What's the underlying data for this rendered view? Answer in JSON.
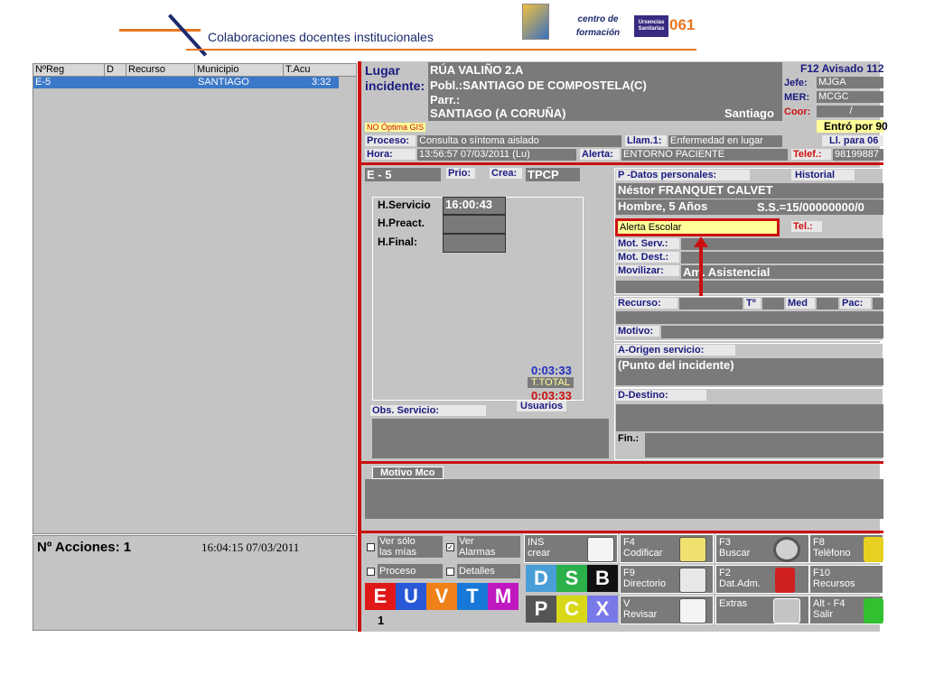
{
  "header": {
    "title": "Colaboraciones docentes institucionales",
    "logo_cf": "centro de formación",
    "logo_urg": "Urxencias Sanitarias",
    "logo_num": "061"
  },
  "list": {
    "columns": [
      "NºReg",
      "D",
      "Recurso",
      "Municipio",
      "T.Acu"
    ],
    "row": {
      "reg": "E-5",
      "municipio": "SANTIAGO",
      "tacu": "3:32"
    }
  },
  "acciones": {
    "label": "Nº Acciones: 1",
    "datetime": "16:04:15  07/03/2011"
  },
  "incident": {
    "lugar_label": "Lugar\nincidente:",
    "addr1": "RÚA VALIÑO 2.A",
    "addr2": "Pobl.:SANTIAGO DE COMPOSTELA(C)",
    "addr3": "Parr.:",
    "addr4": "SANTIAGO  (A CORUÑA)",
    "addr4b": "Santiago",
    "f12": "F12 Avisado 112",
    "jefe_l": "Jefe:",
    "jefe": "MJGA",
    "mer_l": "MER:",
    "mer": "MCGC",
    "coor_l": "Coor:",
    "coor": "/",
    "entro": "Entró por 90",
    "gis": "NO Óptima GIS",
    "proceso_l": "Proceso:",
    "proceso": "Consulta o síntoma aislado",
    "llam_l": "Llam.1:",
    "llam": "Enfermedad en lugar",
    "li": "Ll. para 06",
    "hora_l": "Hora:",
    "hora": "13:56:57  07/03/2011  (Lu)",
    "alerta_l": "Alerta:",
    "alerta": "ENTORNO PACIENTE",
    "telef_l": "Telef.:",
    "telef": "98199887"
  },
  "service": {
    "code": "E - 5",
    "prio_l": "Prio:",
    "crea_l": "Crea:",
    "crea": "TPCP",
    "h_servicio_l": "H.Servicio",
    "h_servicio": "16:00:43",
    "h_preact_l": "H.Preact.",
    "h_final_l": "H.Final:",
    "t1": "0:03:33",
    "ttotal": "T.TOTAL",
    "t2": "0:03:33",
    "obs_l": "Obs. Servicio:",
    "usuarios": "Usuarios"
  },
  "patient": {
    "datos_l": "P -Datos personales:",
    "historial": "Historial",
    "name": "Néstor FRANQUET CALVET",
    "sex_age": "Hombre, 5 Años",
    "ss": "S.S.=15/00000000/0",
    "alerta_esc": "Alerta Escolar",
    "tel_l": "Tel.:",
    "mot_serv_l": "Mot. Serv.:",
    "mot_dest_l": "Mot. Dest.:",
    "movilizar_l": "Movilizar:",
    "movilizar": "Am. Asistencial",
    "recurso_l": "Recurso:",
    "tp_l": "Tº",
    "med_l": "Med",
    "pac_l": "Pac:",
    "motivo_l": "Motivo:",
    "origen_l": "A-Origen servicio:",
    "origen": "(Punto del incidente)",
    "destino_l": "D-Destino:",
    "fin_l": "Fin.:"
  },
  "motivo_mco": "Motivo Mco",
  "controls": {
    "ver_solo": "Ver sólo\nlas mías",
    "ver_alarmas": "Ver\nAlarmas",
    "proceso": "Proceso",
    "detalles": "Detalles",
    "letters": [
      "D",
      "S",
      "B",
      "P",
      "C",
      "X",
      "E",
      "U",
      "V",
      "T",
      "M"
    ],
    "count": "1",
    "ins": "INS\ncrear",
    "f4": "F4\nCodificar",
    "f3": "F3\nBuscar",
    "f8": "F8\nTeléfono",
    "f9": "F9\nDirectorio",
    "f2": "F2\nDat.Adm.",
    "f10": "F10\nRecursos",
    "v": "V\nRevisar",
    "extras": "Extras",
    "altf4": "Alt - F4\nSalir"
  },
  "colors": {
    "red": "#cc1010",
    "blue_sel": "#3b78c8",
    "yellow": "#ffff99"
  }
}
